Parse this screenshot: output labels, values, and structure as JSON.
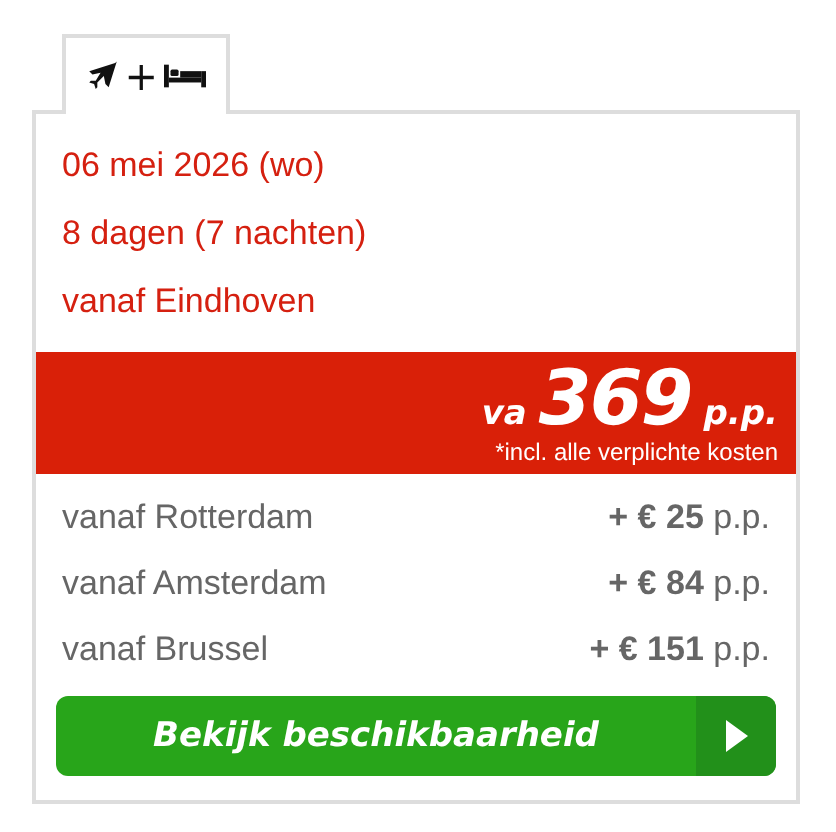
{
  "tabs": [
    {
      "plus": "+",
      "selected": true
    }
  ],
  "details": [
    "06 mei 2026 (wo)",
    "8 dagen (7 nachten)",
    "vanaf Eindhoven"
  ],
  "price": {
    "prefix": "va",
    "amount": "369",
    "suffix": "p.p.",
    "note": "*incl. alle verplichte kosten"
  },
  "alternatives": [
    {
      "label": "vanaf Rotterdam",
      "surcharge": "**+ € 25** p.p."
    },
    {
      "label": "vanaf Amsterdam",
      "surcharge": "**+ € 84** p.p."
    },
    {
      "label": "vanaf Brussel",
      "surcharge": "**+ € 151** p.p."
    }
  ],
  "button": {
    "label": "Bekijk beschikbaarheid"
  }
}
